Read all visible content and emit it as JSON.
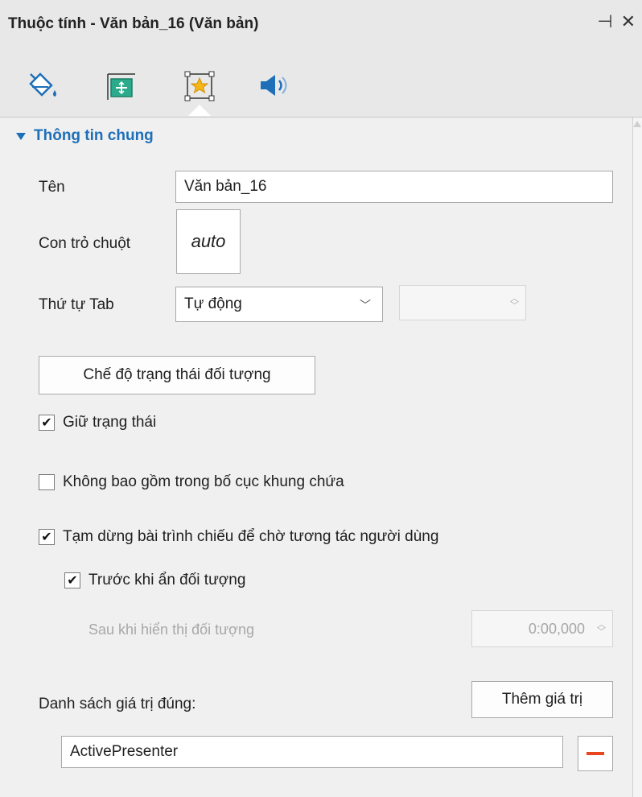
{
  "window": {
    "title": "Thuộc tính - Văn bản_16 (Văn bản)",
    "pin_icon": "pin-icon",
    "close_icon": "close-icon"
  },
  "toolbar": {
    "tabs": [
      {
        "icon": "fill-bucket-icon"
      },
      {
        "icon": "size-position-icon"
      },
      {
        "icon": "interaction-star-icon",
        "active": true
      },
      {
        "icon": "audio-speaker-icon"
      }
    ]
  },
  "section": {
    "title": "Thông tin chung"
  },
  "form": {
    "name_label": "Tên",
    "name_value": "Văn bản_16",
    "cursor_label": "Con trỏ chuột",
    "cursor_value": "auto",
    "tab_order_label": "Thứ tự Tab",
    "tab_order_value": "Tự động",
    "state_mode_button": "Chế độ trạng thái đối tượng",
    "keep_state": {
      "label": "Giữ trạng thái",
      "checked": true
    },
    "exclude_layout": {
      "label": "Không bao gồm trong bố cục khung chứa",
      "checked": false
    },
    "pause_slideshow": {
      "label": "Tạm dừng bài trình chiếu để chờ tương tác người dùng",
      "checked": true
    },
    "before_hide": {
      "label": "Trước khi ẩn đối tượng",
      "checked": true
    },
    "after_show_label": "Sau khi hiển thị đối tượng",
    "after_show_value": "0:00,000",
    "correct_values_label": "Danh sách giá trị đúng:",
    "add_value_button": "Thêm giá trị",
    "correct_value_1": "ActivePresenter"
  },
  "colors": {
    "accent": "#1e6fb8",
    "remove": "#e8461e",
    "panel_bg": "#f0f0f0",
    "header_bg": "#e8e8e8"
  }
}
